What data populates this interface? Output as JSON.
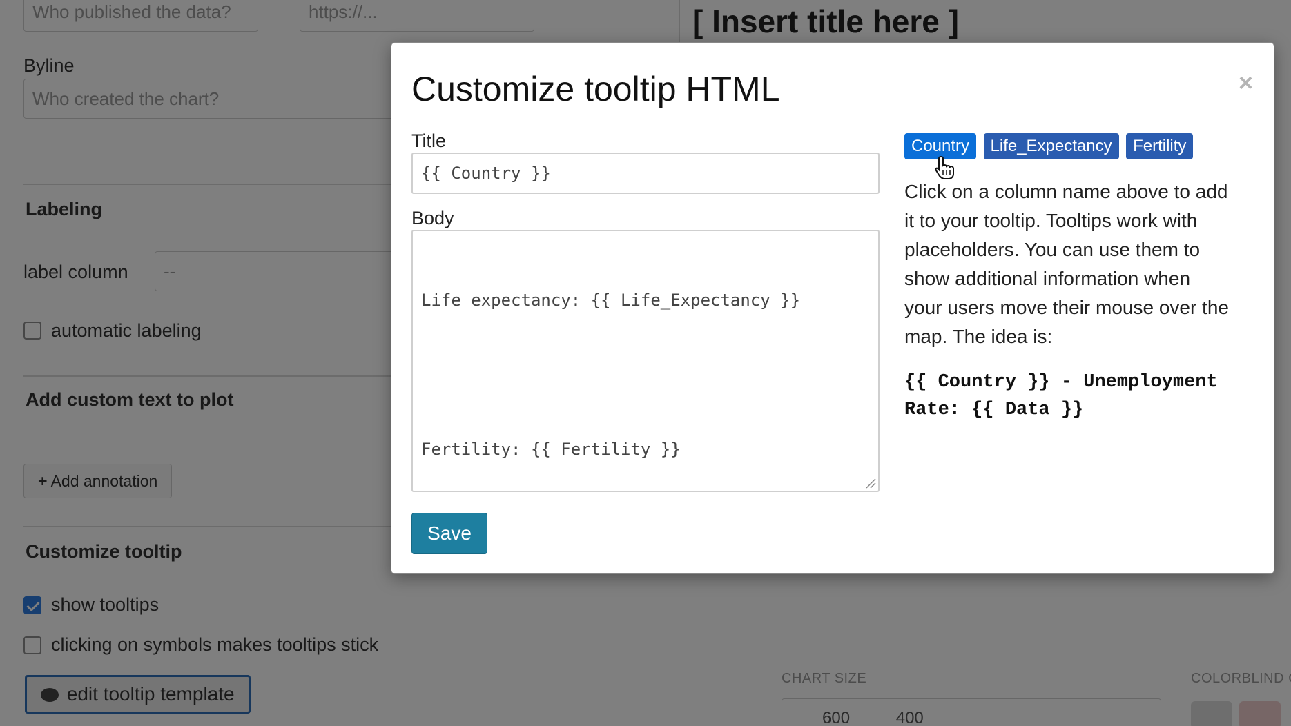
{
  "background": {
    "source_placeholder": "Who published the data?",
    "url_placeholder": "https://...",
    "byline_label": "Byline",
    "byline_placeholder": "Who created the chart?",
    "labeling_heading": "Labeling",
    "label_column_label": "label column",
    "label_column_value": "--",
    "automatic_labeling_label": "automatic labeling",
    "custom_text_heading": "Add custom text to plot",
    "add_annotation_label": "Add annotation",
    "customize_tooltip_heading": "Customize tooltip",
    "show_tooltips_label": "show tooltips",
    "show_tooltips_checked": true,
    "sticky_tooltips_label": "clicking on symbols makes tooltips stick",
    "edit_tooltip_template_label": "edit tooltip template",
    "chart_title": "[ Insert title here ]",
    "chart_size_label": "CHART SIZE",
    "chart_width": "600",
    "chart_height": "400",
    "colorblind_label": "COLORBLIND C"
  },
  "modal": {
    "title": "Customize tooltip HTML",
    "close_symbol": "×",
    "title_field_label": "Title",
    "title_field_value": "{{ Country }}",
    "body_field_label": "Body",
    "body_lines": [
      "Life expectancy: {{ Life_Expectancy }}",
      "",
      "Fertility: {{ Fertility }}"
    ],
    "save_label": "Save",
    "column_tags": [
      "Country",
      "Life_Expectancy",
      "Fertility"
    ],
    "help_text": "Click on a column name above to add it to your tooltip. Tooltips work with placeholders. You can use them to show additional information when your users move their mouse over the map. The idea is:",
    "help_example": "{{ Country }} - Unemployment Rate: {{ Data }}"
  },
  "colors": {
    "backdrop": "#00000080",
    "save_button": "#1e7fa0",
    "tag": "#2a5cb0",
    "tag_active": "#0b6fd8"
  }
}
